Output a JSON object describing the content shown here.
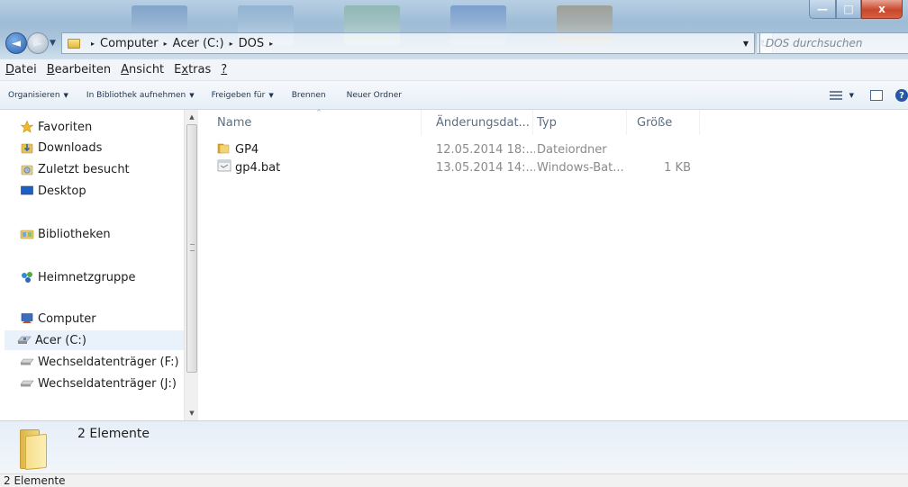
{
  "window": {
    "minimize_glyph": "—",
    "maximize_glyph": "□",
    "close_glyph": "x"
  },
  "nav": {
    "back_glyph": "◄",
    "forward_glyph": "►",
    "history_glyph": "▼"
  },
  "address": {
    "breadcrumbs": [
      "Computer",
      "Acer (C:)",
      "DOS"
    ],
    "separator": "▸",
    "dropdown_glyph": "▼",
    "refresh_glyph": "↻"
  },
  "search": {
    "placeholder": "DOS durchsuchen"
  },
  "menu": {
    "items": [
      {
        "accel": "D",
        "rest": "atei"
      },
      {
        "accel": "B",
        "rest": "earbeiten"
      },
      {
        "accel": "A",
        "rest": "nsicht"
      },
      {
        "pre": "E",
        "accel": "x",
        "rest": "tras"
      },
      {
        "accel": "?",
        "rest": ""
      }
    ]
  },
  "toolbar": {
    "organize": "Organisieren",
    "include_library": "In Bibliothek aufnehmen",
    "share": "Freigeben für",
    "burn": "Brennen",
    "new_folder": "Neuer Ordner",
    "drop_glyph": "▼",
    "help_glyph": "?"
  },
  "navpane": {
    "favorites": "Favoriten",
    "downloads": "Downloads",
    "recent": "Zuletzt besucht",
    "desktop": "Desktop",
    "libraries": "Bibliotheken",
    "homegroup": "Heimnetzgruppe",
    "computer": "Computer",
    "drive_c": "Acer (C:)",
    "drive_f": "Wechseldatenträger (F:)",
    "drive_j": "Wechseldatenträger (J:)",
    "scroll_up_glyph": "▲",
    "scroll_down_glyph": "▼"
  },
  "filelist": {
    "columns": [
      "Name",
      "Änderungsdat...",
      "Typ",
      "Größe"
    ],
    "sort_glyph": "^",
    "rows": [
      {
        "name": "GP4",
        "date": "12.05.2014 18:...",
        "type": "Dateiordner",
        "size": "",
        "icon": "folder-icon"
      },
      {
        "name": "gp4.bat",
        "date": "13.05.2014 14:...",
        "type": "Windows-Bat...",
        "size": "1 KB",
        "icon": "batch-file-icon"
      }
    ]
  },
  "details": {
    "count": "2 Elemente"
  },
  "status": {
    "text": "2 Elemente"
  },
  "colors": {
    "titlebar": "#9fbcd6",
    "close_button": "#c8472c",
    "accent_blue": "#2458a5",
    "folder_yellow": "#e3b73c"
  }
}
